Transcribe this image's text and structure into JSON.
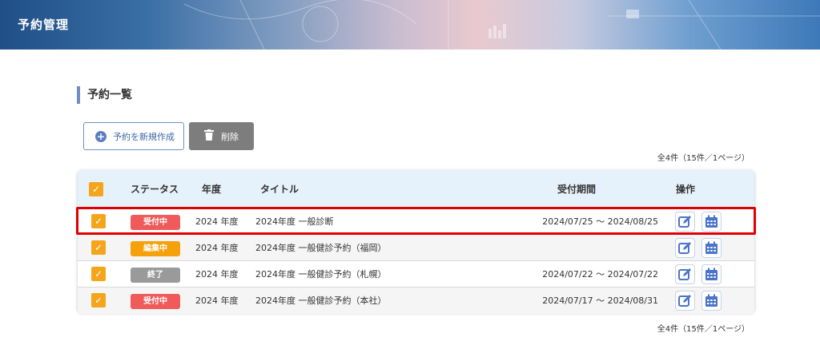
{
  "header": {
    "title": "予約管理"
  },
  "section": {
    "title": "予約一覧"
  },
  "toolbar": {
    "new_label": "予約を新規作成",
    "delete_label": "削除"
  },
  "pagination": {
    "summary": "全4件（15件／1ページ）"
  },
  "table": {
    "headers": {
      "status": "ステータス",
      "year": "年度",
      "title": "タイトル",
      "period": "受付期間",
      "actions": "操作"
    },
    "rows": [
      {
        "status": "受付中",
        "status_color": "#f05a5a",
        "year": "2024 年度",
        "title": "2024年度 一般診断",
        "period": "2024/07/25 ～ 2024/08/25"
      },
      {
        "status": "編集中",
        "status_color": "#f5a10c",
        "year": "2024 年度",
        "title": "2024年度 一般健診予約（福岡）",
        "period": ""
      },
      {
        "status": "終了",
        "status_color": "#9a9a9a",
        "year": "2024 年度",
        "title": "2024年度 一般健診予約（札幌）",
        "period": "2024/07/22 ～ 2024/07/22"
      },
      {
        "status": "受付中",
        "status_color": "#f05a5a",
        "year": "2024 年度",
        "title": "2024年度 一般健診予約（本社）",
        "period": "2024/07/17 ～ 2024/08/31"
      }
    ]
  },
  "icons": {
    "edit": "edit-icon",
    "calendar": "calendar-icon",
    "plus": "plus-circle-icon",
    "trash": "trash-icon",
    "check": "check-icon"
  },
  "colors": {
    "accent": "#5a7fc0",
    "checkbox": "#f5a51c",
    "highlight": "#e00000",
    "icon_blue": "#4a74c9"
  }
}
